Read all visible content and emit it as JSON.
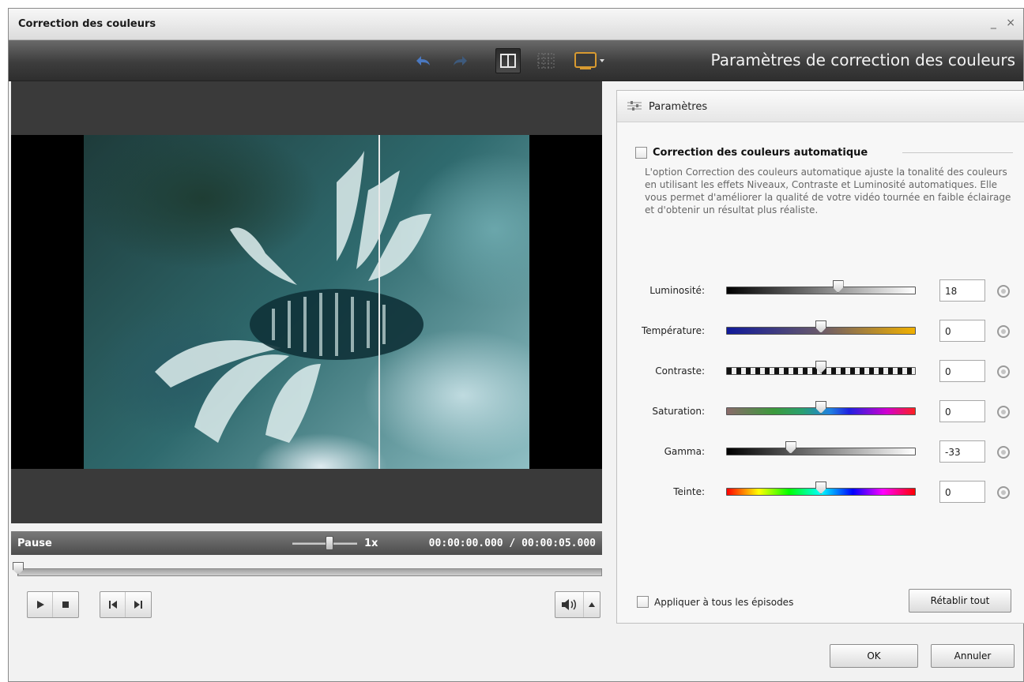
{
  "window": {
    "title": "Correction des couleurs",
    "controls": "_ ×"
  },
  "toolbar": {
    "heading": "Paramètres de correction des couleurs",
    "icons": [
      "undo-icon",
      "redo-icon",
      "split-view-icon",
      "grid-view-icon",
      "preview-monitor-icon"
    ]
  },
  "player": {
    "status": "Pause",
    "speed": "1x",
    "speed_level": 0.55,
    "time": "00:00:00.000 / 00:00:05.000",
    "progress": 0
  },
  "panel": {
    "title": "Paramètres",
    "auto_correction": {
      "label": "Correction des couleurs automatique",
      "checked": false,
      "description": "L'option Correction des couleurs automatique ajuste la tonalité des couleurs en utilisant les effets Niveaux, Contraste et Luminosité automatiques. Elle vous permet d'améliorer la qualité de votre vidéo tournée en faible éclairage et d'obtenir un résultat plus réaliste."
    },
    "sliders": [
      {
        "label": "Luminosité:",
        "value": "18",
        "level": 0.59,
        "gradient": "linear-gradient(90deg,#000,#fff)"
      },
      {
        "label": "Température:",
        "value": "0",
        "level": 0.5,
        "gradient": "linear-gradient(90deg,#101a9a,#6a5a6a 50%,#f0b000)"
      },
      {
        "label": "Contraste:",
        "value": "0",
        "level": 0.5,
        "gradient": "repeating-linear-gradient(90deg,#111 0,#111 6px,#eee 6px,#eee 12px)"
      },
      {
        "label": "Saturation:",
        "value": "0",
        "level": 0.5,
        "gradient": "linear-gradient(90deg,#8a6a6a,#3c9a3c 25%,#2aa070 40%,#2080e0 55%,#2020e0 65%,#d000d0 85%,#ff2020)"
      },
      {
        "label": "Gamma:",
        "value": "-33",
        "level": 0.34,
        "gradient": "linear-gradient(90deg,#000,#fff)"
      },
      {
        "label": "Teinte:",
        "value": "0",
        "level": 0.5,
        "gradient": "linear-gradient(90deg,#ff0000,#ffff00 17%,#00ff00 33%,#00ffff 50%,#0000ff 67%,#ff00ff 83%,#ff0000)"
      }
    ],
    "apply_all": {
      "label": "Appliquer à tous les épisodes",
      "checked": false
    },
    "reset_all": "Rétablir tout"
  },
  "buttons": {
    "ok": "OK",
    "cancel": "Annuler"
  }
}
